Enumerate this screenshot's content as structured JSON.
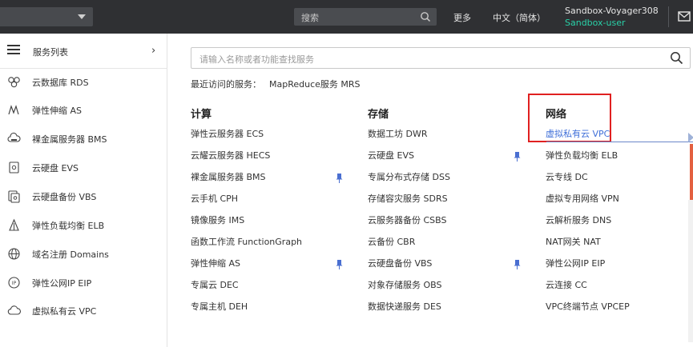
{
  "topbar": {
    "search_placeholder": "搜索",
    "more_label": "更多",
    "language_label": "中文（简体）",
    "account_name": "Sandbox-Voyager308",
    "user_name": "Sandbox-user"
  },
  "sidebar": {
    "title": "服务列表",
    "items": [
      {
        "label": "云数据库 RDS",
        "icon": "database-icon"
      },
      {
        "label": "弹性伸缩 AS",
        "icon": "auto-scaling-icon"
      },
      {
        "label": "裸金属服务器 BMS",
        "icon": "cloud-server-icon"
      },
      {
        "label": "云硬盘 EVS",
        "icon": "disk-icon"
      },
      {
        "label": "云硬盘备份 VBS",
        "icon": "disk-backup-icon"
      },
      {
        "label": "弹性负载均衡 ELB",
        "icon": "load-balancer-icon"
      },
      {
        "label": "域名注册 Domains",
        "icon": "globe-icon"
      },
      {
        "label": "弹性公网IP EIP",
        "icon": "ip-icon"
      },
      {
        "label": "虚拟私有云 VPC",
        "icon": "cloud-icon"
      }
    ]
  },
  "main": {
    "search_placeholder": "请输入名称或者功能查找服务",
    "recent_label": "最近访问的服务：",
    "recent_service": "MapReduce服务 MRS",
    "columns": [
      {
        "title": "计算",
        "items": [
          {
            "label": "弹性云服务器 ECS"
          },
          {
            "label": "云耀云服务器 HECS"
          },
          {
            "label": "裸金属服务器 BMS",
            "pinned": true
          },
          {
            "label": "云手机 CPH"
          },
          {
            "label": "镜像服务 IMS"
          },
          {
            "label": "函数工作流 FunctionGraph"
          },
          {
            "label": "弹性伸缩 AS",
            "pinned": true
          },
          {
            "label": "专属云 DEC"
          },
          {
            "label": "专属主机 DEH"
          }
        ]
      },
      {
        "title": "存储",
        "items": [
          {
            "label": "数据工坊 DWR"
          },
          {
            "label": "云硬盘 EVS",
            "pinned": true
          },
          {
            "label": "专属分布式存储 DSS"
          },
          {
            "label": "存储容灾服务 SDRS"
          },
          {
            "label": "云服务器备份 CSBS"
          },
          {
            "label": "云备份 CBR"
          },
          {
            "label": "云硬盘备份 VBS",
            "pinned": true
          },
          {
            "label": "对象存储服务 OBS"
          },
          {
            "label": "数据快递服务 DES"
          }
        ]
      },
      {
        "title": "网络",
        "items": [
          {
            "label": "虚拟私有云 VPC",
            "active": true
          },
          {
            "label": "弹性负载均衡 ELB"
          },
          {
            "label": "云专线 DC"
          },
          {
            "label": "虚拟专用网络 VPN"
          },
          {
            "label": "云解析服务 DNS"
          },
          {
            "label": "NAT网关 NAT"
          },
          {
            "label": "弹性公网IP EIP"
          },
          {
            "label": "云连接 CC"
          },
          {
            "label": "VPC终端节点 VPCEP"
          }
        ]
      }
    ]
  },
  "colors": {
    "topbar_bg": "#2f3033",
    "accent_green": "#29d1a8",
    "link_blue": "#3f6fd8",
    "highlight_red": "#e02020",
    "pin_blue": "#4a6fd1"
  }
}
